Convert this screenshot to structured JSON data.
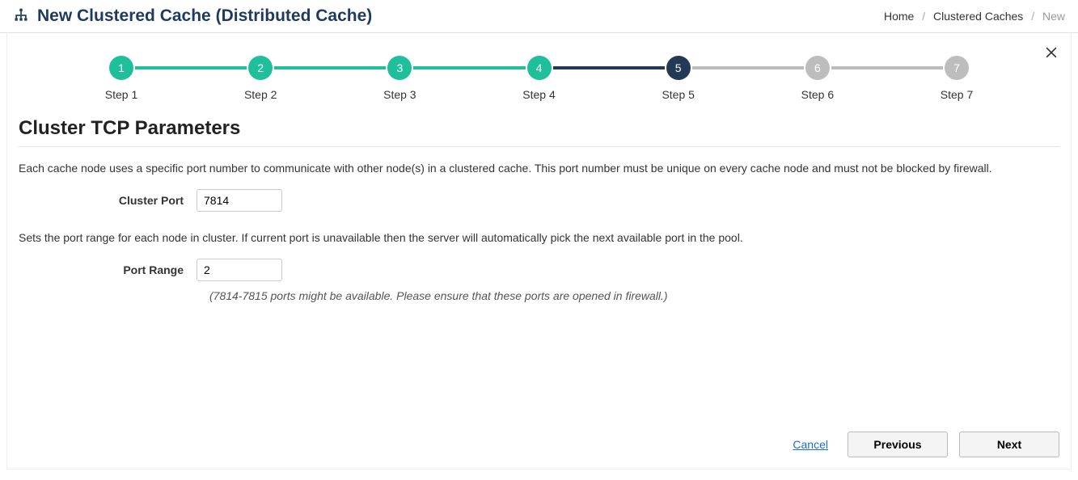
{
  "header": {
    "title": "New Clustered Cache (Distributed Cache)"
  },
  "breadcrumb": {
    "home": "Home",
    "caches": "Clustered Caches",
    "current": "New"
  },
  "stepper": {
    "steps": [
      {
        "num": "1",
        "label": "Step 1",
        "state": "completed"
      },
      {
        "num": "2",
        "label": "Step 2",
        "state": "completed"
      },
      {
        "num": "3",
        "label": "Step 3",
        "state": "completed"
      },
      {
        "num": "4",
        "label": "Step 4",
        "state": "completed"
      },
      {
        "num": "5",
        "label": "Step 5",
        "state": "active"
      },
      {
        "num": "6",
        "label": "Step 6",
        "state": "pending"
      },
      {
        "num": "7",
        "label": "Step 7",
        "state": "pending"
      }
    ]
  },
  "section": {
    "title": "Cluster TCP Parameters",
    "desc1": "Each cache node uses a specific port number to communicate with other node(s) in a clustered cache. This port number must be unique on every cache node and must not be blocked by firewall.",
    "clusterPortLabel": "Cluster Port",
    "clusterPortValue": "7814",
    "desc2": "Sets the port range for each node in cluster. If current port is unavailable then the server will automatically pick the next available port in the pool.",
    "portRangeLabel": "Port Range",
    "portRangeValue": "2",
    "hint": "(7814-7815 ports might be available. Please ensure that these ports are opened in firewall.)"
  },
  "footer": {
    "cancel": "Cancel",
    "previous": "Previous",
    "next": "Next"
  }
}
